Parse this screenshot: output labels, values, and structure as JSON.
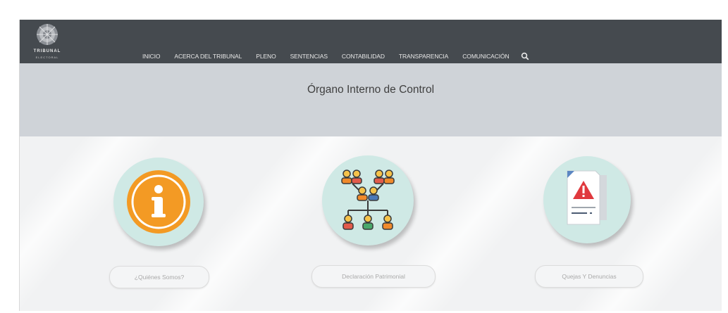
{
  "header": {
    "logo_text": "TRIBUNAL",
    "logo_sub": "ELECTORAL",
    "nav": [
      {
        "label": "INICIO"
      },
      {
        "label": "ACERCA DEL TRIBUNAL"
      },
      {
        "label": "PLENO"
      },
      {
        "label": "SENTENCIAS"
      },
      {
        "label": "CONTABILIDAD"
      },
      {
        "label": "TRANSPARENCIA"
      },
      {
        "label": "COMUNICACIÓN"
      }
    ],
    "search_icon": "search-icon"
  },
  "page": {
    "title": "Órgano Interno de Control"
  },
  "cards": [
    {
      "icon": "info-icon",
      "button_label": "¿Quiénes Somos?"
    },
    {
      "icon": "org-chart-icon",
      "button_label": "Declaración Patrimonial"
    },
    {
      "icon": "warning-document-icon",
      "button_label": "Quejas Y Denuncias"
    }
  ],
  "colors": {
    "topbar": "#454a4f",
    "titlebar": "#cfd3d8",
    "circle_bg": "#cfe9e5",
    "info_orange": "#f39a24"
  }
}
